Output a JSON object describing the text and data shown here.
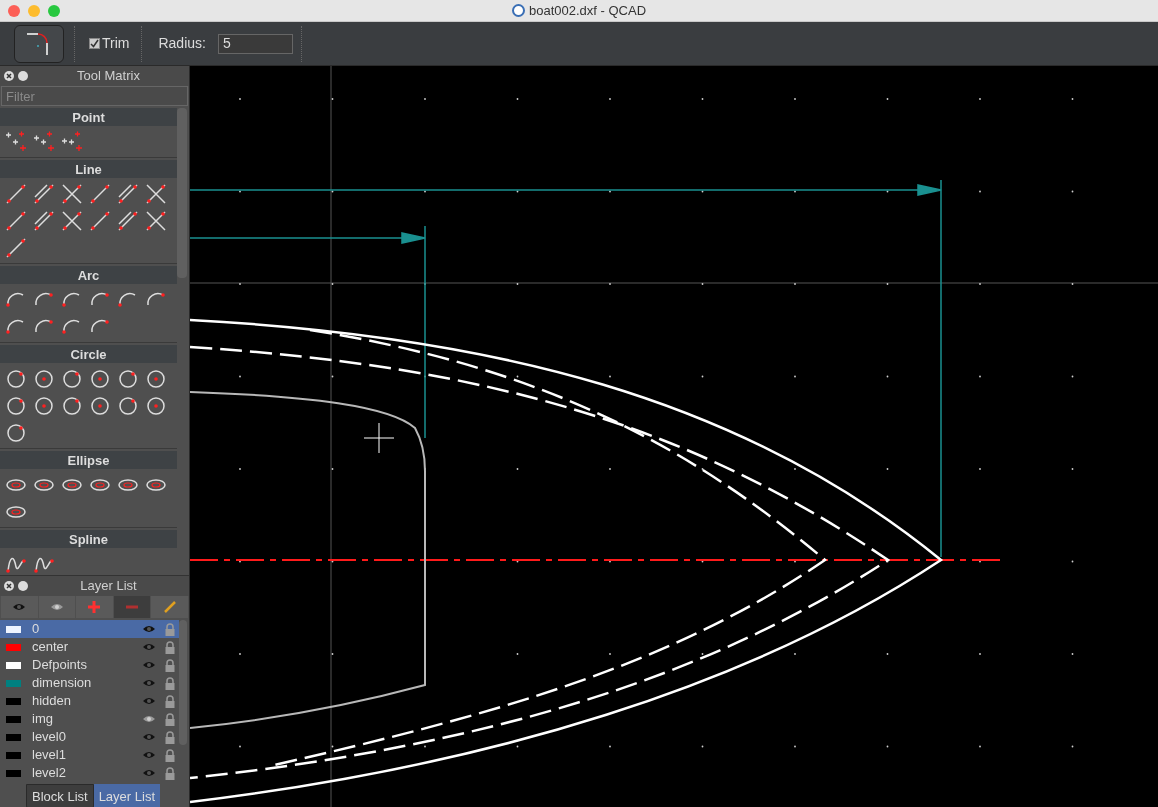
{
  "window": {
    "title": "boat002.dxf - QCAD"
  },
  "toolbar": {
    "trim": {
      "label": "Trim",
      "checked": true
    },
    "radius": {
      "label": "Radius:",
      "value": "5"
    }
  },
  "tool_matrix": {
    "title": "Tool Matrix",
    "filter": {
      "placeholder": "Filter"
    },
    "sections": [
      {
        "title": "Point",
        "kind": "point"
      },
      {
        "title": "Line",
        "kind": "line"
      },
      {
        "title": "Arc",
        "kind": "arc"
      },
      {
        "title": "Circle",
        "kind": "circle"
      },
      {
        "title": "Ellipse",
        "kind": "ellipse"
      },
      {
        "title": "Spline",
        "kind": "spline"
      }
    ]
  },
  "layer_list": {
    "title": "Layer List",
    "layers": [
      {
        "name": "0",
        "color": "#eef4ff",
        "visible": true,
        "selected": true
      },
      {
        "name": "center",
        "color": "#ff0000",
        "visible": true,
        "selected": false
      },
      {
        "name": "Defpoints",
        "color": "#ffffff",
        "visible": true,
        "selected": false
      },
      {
        "name": "dimension",
        "color": "#008080",
        "visible": true,
        "selected": false
      },
      {
        "name": "hidden",
        "color": "#000000",
        "visible": true,
        "selected": false
      },
      {
        "name": "img",
        "color": "#000000",
        "visible": false,
        "selected": false
      },
      {
        "name": "level0",
        "color": "#000000",
        "visible": true,
        "selected": false
      },
      {
        "name": "level1",
        "color": "#000000",
        "visible": true,
        "selected": false
      },
      {
        "name": "level2",
        "color": "#000000",
        "visible": true,
        "selected": false
      }
    ]
  },
  "dock_tabs": [
    {
      "label": "Block List",
      "selected": false
    },
    {
      "label": "Layer List",
      "selected": true
    }
  ]
}
